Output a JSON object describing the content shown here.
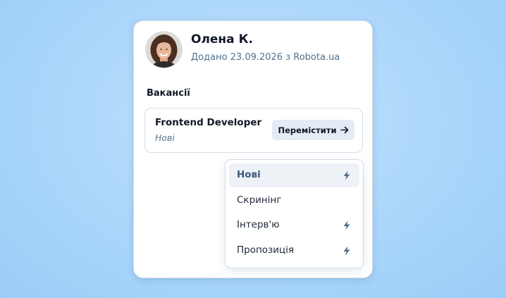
{
  "candidate": {
    "name": "Олена К.",
    "added_text": "Додано 23.09.2026 з Robota.ua",
    "avatar_icon": "avatar-photo"
  },
  "vacancies": {
    "section_title": "Вакансії",
    "job": {
      "title": "Frontend Developer",
      "stage": "Нові",
      "move_label": "Перемістити",
      "move_icon": "arrow-right-icon"
    }
  },
  "stage_menu": {
    "items": [
      {
        "label": "Нові",
        "active": true,
        "automation": true
      },
      {
        "label": "Скринінг",
        "active": false,
        "automation": false
      },
      {
        "label": "Інтерв'ю",
        "active": false,
        "automation": true
      },
      {
        "label": "Пропозиція",
        "active": false,
        "automation": true
      }
    ],
    "automation_icon": "lightning-bolt-icon"
  },
  "colors": {
    "accent_text": "#3d5a7a",
    "muted_text": "#53708d",
    "button_bg": "#e3ebf5",
    "active_item_bg": "#eef2f7"
  }
}
